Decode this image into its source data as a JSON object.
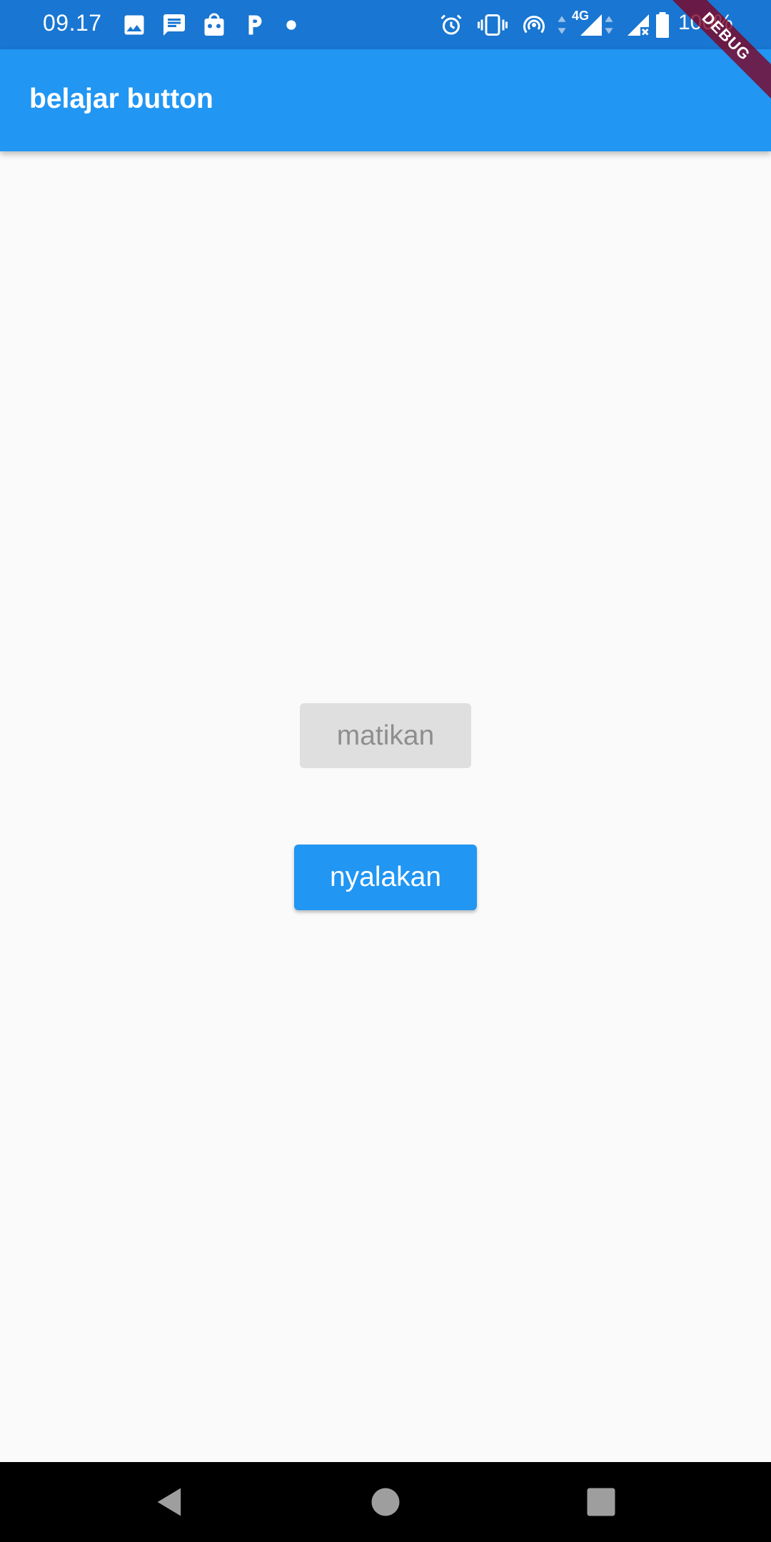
{
  "status_bar": {
    "time": "09.17",
    "battery": "100%",
    "network": "4G",
    "icons": [
      "image-icon",
      "message-icon",
      "bag-icon",
      "p-app-icon",
      "dot-icon",
      "alarm-icon",
      "vibrate-icon",
      "hotspot-icon",
      "data-arrows-icon",
      "signal-icon",
      "signal-no-sim-icon",
      "battery-icon"
    ]
  },
  "app_bar": {
    "title": "belajar button",
    "color": "#2196f3"
  },
  "debug_banner": {
    "label": "DEBUG"
  },
  "buttons": {
    "disabled_label": "matikan",
    "primary_label": "nyalakan"
  },
  "nav_bar": {
    "icons": [
      "back-icon",
      "home-icon",
      "recents-icon"
    ]
  }
}
